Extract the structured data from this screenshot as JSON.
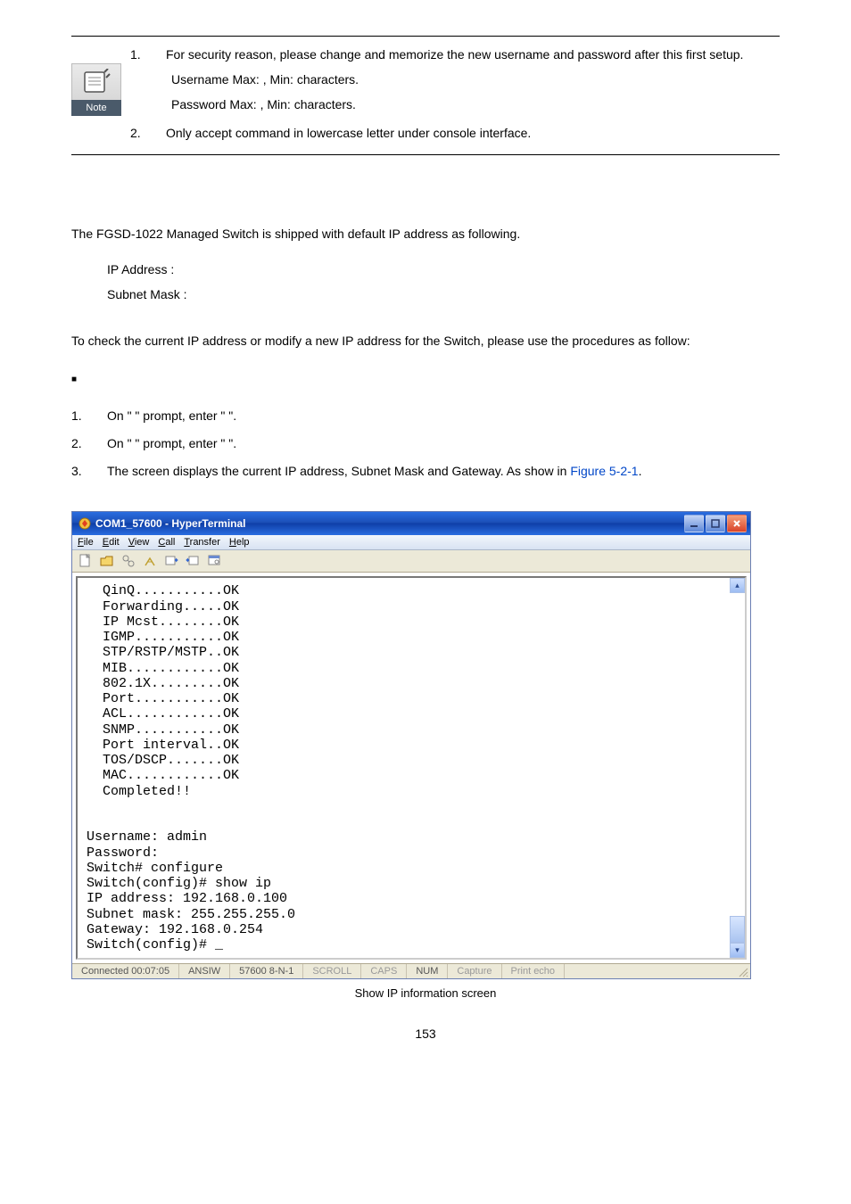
{
  "note": {
    "label": "Note",
    "items": [
      {
        "num": "1.",
        "text": "For security reason, please change and memorize the new username and password after this first setup.",
        "sub": [
          " Username Max:   , Min:    characters.",
          " Password Max:   , Min:    characters."
        ]
      },
      {
        "num": "2.",
        "text": "Only accept command in lowercase letter under console interface."
      }
    ]
  },
  "intro": "The FGSD-1022 Managed Switch is shipped with default IP address as following.",
  "ip_block": {
    "line1": "IP Address : ",
    "line2": "Subnet Mask : "
  },
  "procedure_intro": "To check the current IP address or modify a new IP address for the Switch, please use the procedures as follow:",
  "bullet_blank": " ",
  "steps": [
    {
      "num": "1.",
      "text": "On \"                 \" prompt, enter \"                   \"."
    },
    {
      "num": "2.",
      "text": "On \"                             \" prompt, enter \"              \"."
    },
    {
      "num": "3.",
      "text_prefix": "The screen displays the current IP address, Subnet Mask and Gateway. As show in ",
      "link": "Figure 5-2-1",
      "text_suffix": "."
    }
  ],
  "window": {
    "title": "COM1_57600 - HyperTerminal",
    "menu": [
      "File",
      "Edit",
      "View",
      "Call",
      "Transfer",
      "Help"
    ],
    "terminal": "  QinQ...........OK\n  Forwarding.....OK\n  IP Mcst........OK\n  IGMP...........OK\n  STP/RSTP/MSTP..OK\n  MIB............OK\n  802.1X.........OK\n  Port...........OK\n  ACL............OK\n  SNMP...........OK\n  Port interval..OK\n  TOS/DSCP.......OK\n  MAC............OK\n  Completed!!\n\n\nUsername: admin\nPassword:\nSwitch# configure\nSwitch(config)# show ip\nIP address: 192.168.0.100\nSubnet mask: 255.255.255.0\nGateway: 192.168.0.254\nSwitch(config)# _",
    "status": {
      "connected": "Connected 00:07:05",
      "emulation": "ANSIW",
      "settings": "57600 8-N-1",
      "scroll": "SCROLL",
      "caps": "CAPS",
      "num": "NUM",
      "capture": "Capture",
      "printecho": "Print echo"
    }
  },
  "figure_caption": " Show IP information screen",
  "page_number": "153"
}
